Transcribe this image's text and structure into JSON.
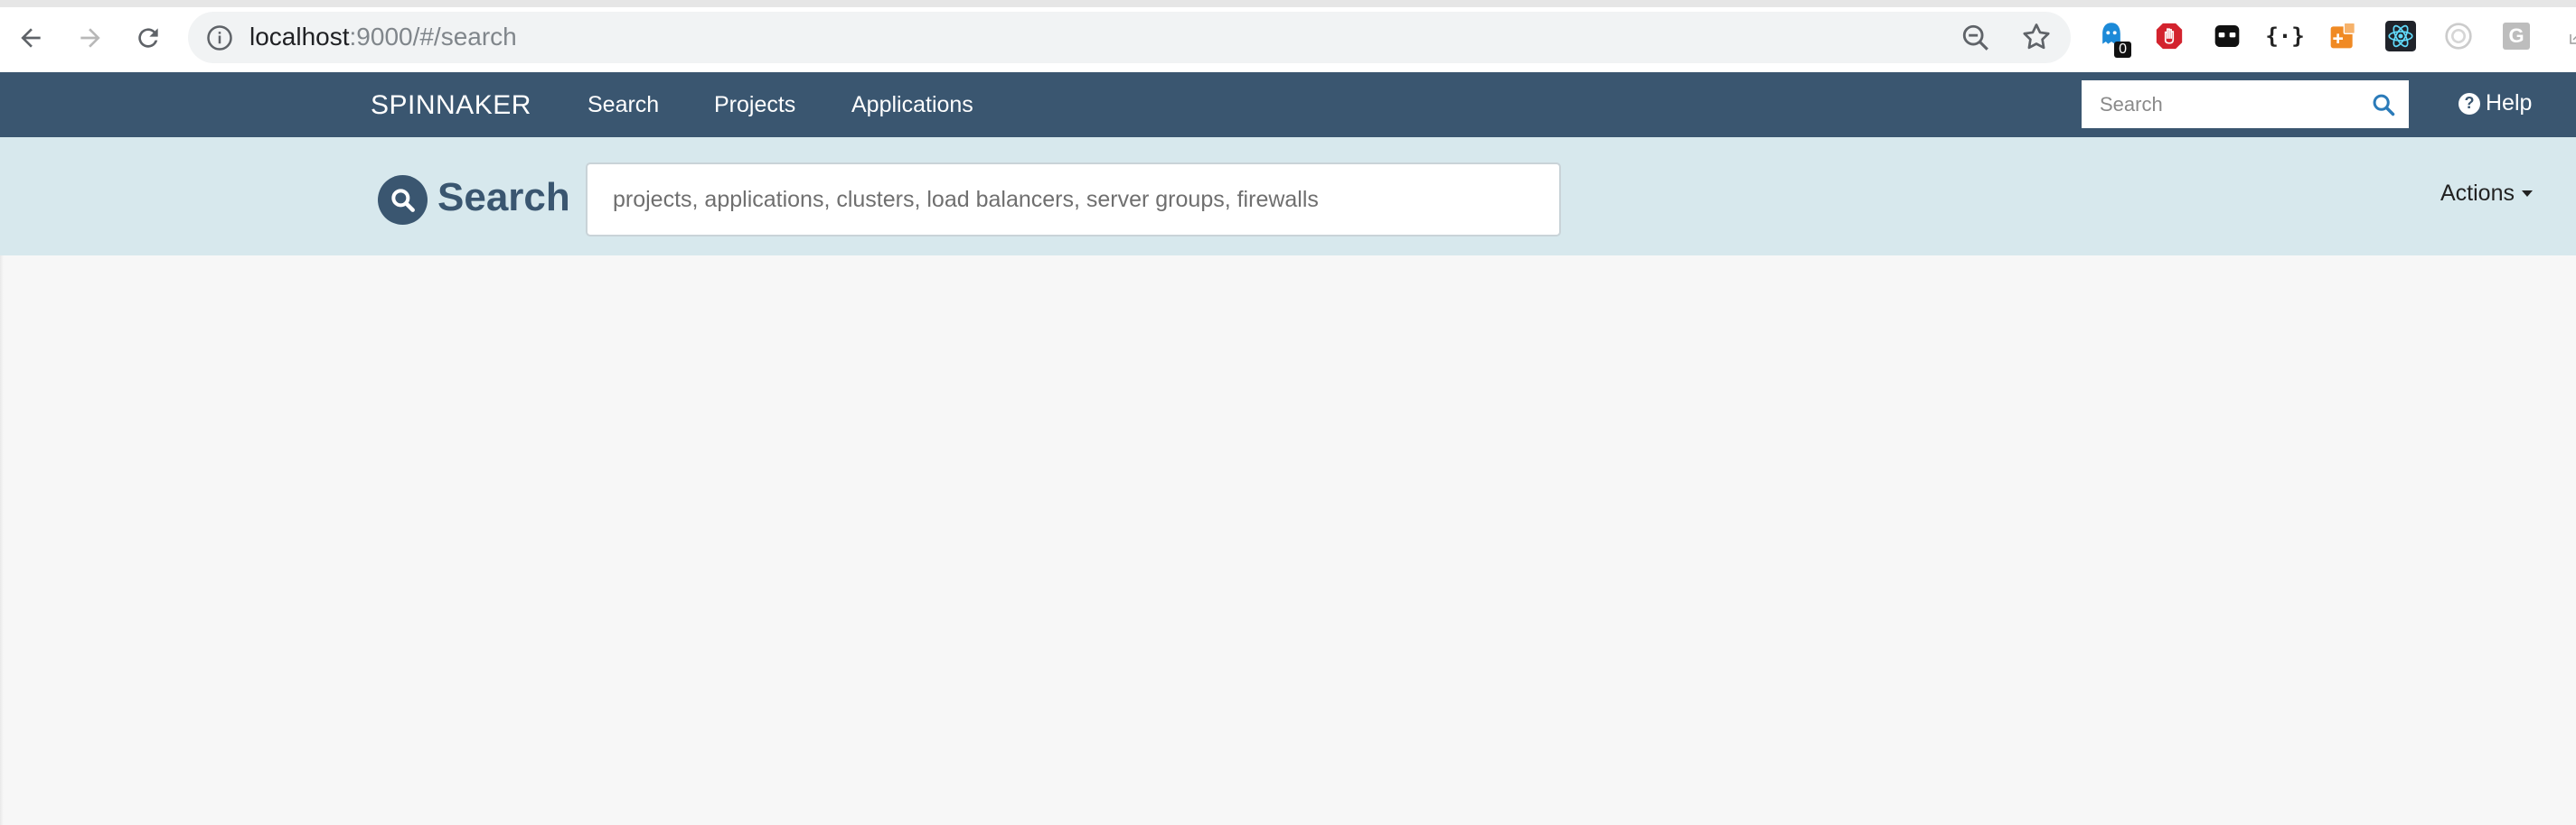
{
  "browser": {
    "url_host": "localhost",
    "url_rest": ":9000/#/search",
    "extensions": [
      {
        "icon": "ghostery-icon",
        "badge": "0",
        "color": "#1c8ad8"
      },
      {
        "icon": "hand-stop-icon",
        "color": "#d3232e"
      },
      {
        "icon": "mask-icon",
        "color": "#111111"
      },
      {
        "icon": "json-braces-icon",
        "label": "{·}",
        "color": "#222222"
      },
      {
        "icon": "orange-extension-icon",
        "color": "#f08a24"
      },
      {
        "icon": "react-devtools-icon",
        "color": "#61dafb"
      },
      {
        "icon": "circle-extension-icon",
        "color": "#cccccc"
      },
      {
        "icon": "g-extension-icon",
        "label": "G",
        "color": "#bdbdbd"
      }
    ]
  },
  "header": {
    "brand": "SPINNAKER",
    "nav": {
      "search": "Search",
      "projects": "Projects",
      "applications": "Applications"
    },
    "search_placeholder": "Search",
    "help": "Help"
  },
  "subheader": {
    "title": "Search",
    "search_placeholder": "projects, applications, clusters, load balancers, server groups, firewalls",
    "actions": "Actions"
  },
  "colors": {
    "header_bg": "#3a5670",
    "subheader_bg": "#d7e8ed",
    "body_bg": "#f7f7f7",
    "accent": "#2b7bb9"
  }
}
